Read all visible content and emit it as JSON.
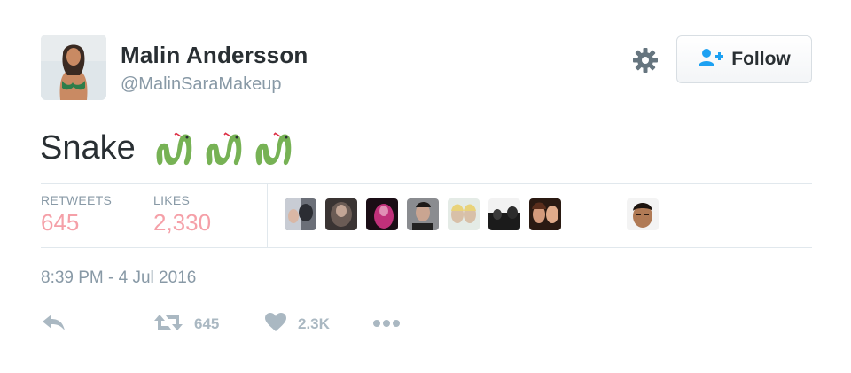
{
  "author": {
    "name": "Malin Andersson",
    "handle": "@MalinSaraMakeup"
  },
  "follow_button": {
    "label": "Follow",
    "icon": "follow-user-plus-icon",
    "accent": "#1da1f2"
  },
  "settings_icon": "gear-icon",
  "tweet": {
    "text": "Snake",
    "emoji": [
      "snake-emoji",
      "snake-emoji",
      "snake-emoji"
    ]
  },
  "stats": {
    "retweets_label": "RETWEETS",
    "retweets_value": "645",
    "likes_label": "LIKES",
    "likes_value": "2,330",
    "value_color": "#f5a0a8"
  },
  "likers_count_shown": 9,
  "timestamp": "8:39 PM - 4 Jul 2016",
  "actions": {
    "reply_icon": "reply-icon",
    "retweet_icon": "retweet-icon",
    "retweet_count": "645",
    "like_icon": "heart-icon",
    "like_count": "2.3K",
    "more_icon": "more-dots-icon"
  }
}
